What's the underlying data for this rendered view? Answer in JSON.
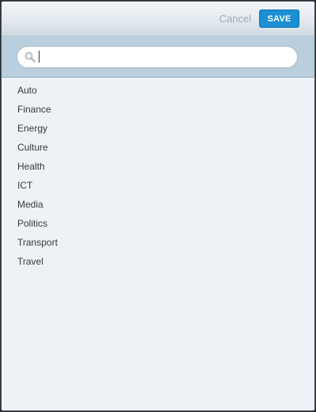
{
  "toolbar": {
    "cancel_label": "Cancel",
    "save_label": "SAVE"
  },
  "search": {
    "value": "",
    "placeholder": ""
  },
  "icons": {
    "search": "search-icon"
  },
  "colors": {
    "accent": "#1a8fd3",
    "search_bar_bg": "#b9cfdd",
    "list_bg": "#edf2f6"
  },
  "categories": [
    "Auto",
    "Finance",
    "Energy",
    "Culture",
    "Health",
    "ICT",
    "Media",
    "Politics",
    "Transport",
    "Travel"
  ]
}
